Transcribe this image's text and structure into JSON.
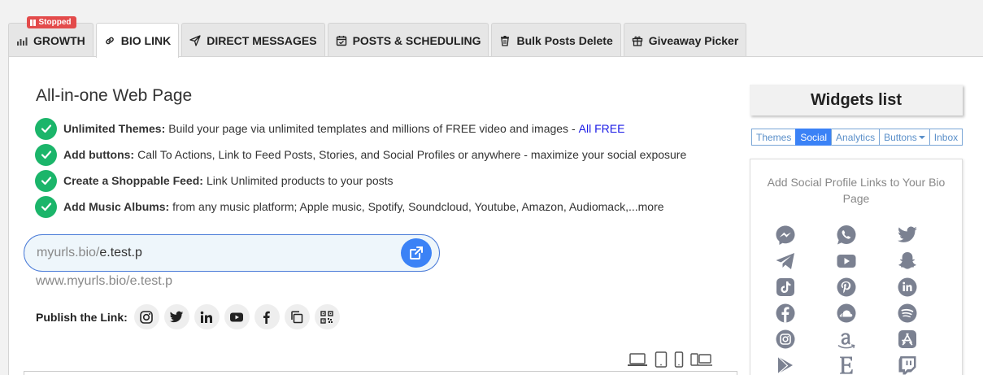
{
  "tabs": [
    {
      "label": "GROWTH",
      "icon": "bar-chart-icon",
      "badge": "Stopped"
    },
    {
      "label": "BIO LINK",
      "icon": "link-icon",
      "active": true
    },
    {
      "label": "DIRECT MESSAGES",
      "icon": "send-icon"
    },
    {
      "label": "POSTS & SCHEDULING",
      "icon": "calendar-icon"
    },
    {
      "label": "Bulk Posts Delete",
      "icon": "trash-icon"
    },
    {
      "label": "Giveaway Picker",
      "icon": "gift-icon"
    }
  ],
  "main": {
    "title": "All-in-one Web Page",
    "features": [
      {
        "bold": "Unlimited Themes:",
        "text": "Build your page via unlimited templates and millions of FREE video and images -",
        "link": "All FREE"
      },
      {
        "bold": "Add buttons:",
        "text": "Call To Actions, Link to Feed Posts, Stories, and Social Profiles or anywhere - maximize your social exposure"
      },
      {
        "bold": "Create a Shoppable Feed:",
        "text": "Link Unlimited products to your posts"
      },
      {
        "bold": "Add Music Albums:",
        "text": "from any music platform; Apple music, Spotify, Soundcloud, Youtube, Amazon, Audiomack,...more"
      }
    ],
    "url_prefix": "myurls.bio/",
    "url_value": "e.test.p",
    "full_url": "www.myurls.bio/e.test.p",
    "publish_label": "Publish the Link:",
    "publish_icons": [
      "instagram-icon",
      "twitter-icon",
      "linkedin-icon",
      "youtube-icon",
      "facebook-icon",
      "copy-icon",
      "qr-code-icon"
    ],
    "device_icons": [
      "laptop-icon",
      "tablet-icon",
      "phone-icon",
      "multi-device-icon"
    ]
  },
  "widgets": {
    "title": "Widgets list",
    "tabs": [
      "Themes",
      "Social",
      "Analytics",
      "Buttons",
      "Inbox"
    ],
    "active_tab": "Social",
    "description": "Add Social Profile Links to Your Bio Page",
    "icons": [
      "messenger-icon",
      "whatsapp-icon",
      "twitter-icon",
      "telegram-icon",
      "youtube-icon",
      "snapchat-icon",
      "tiktok-icon",
      "pinterest-icon",
      "linkedin-icon",
      "facebook-icon",
      "soundcloud-icon",
      "spotify-icon",
      "instagram-icon",
      "amazon-icon",
      "app-store-icon",
      "google-play-icon",
      "etsy-icon",
      "twitch-icon"
    ]
  },
  "colors": {
    "accent": "#3b82f6",
    "check": "#1bb56a",
    "badge": "#e34b4b",
    "widget_icon": "#7b8191"
  }
}
